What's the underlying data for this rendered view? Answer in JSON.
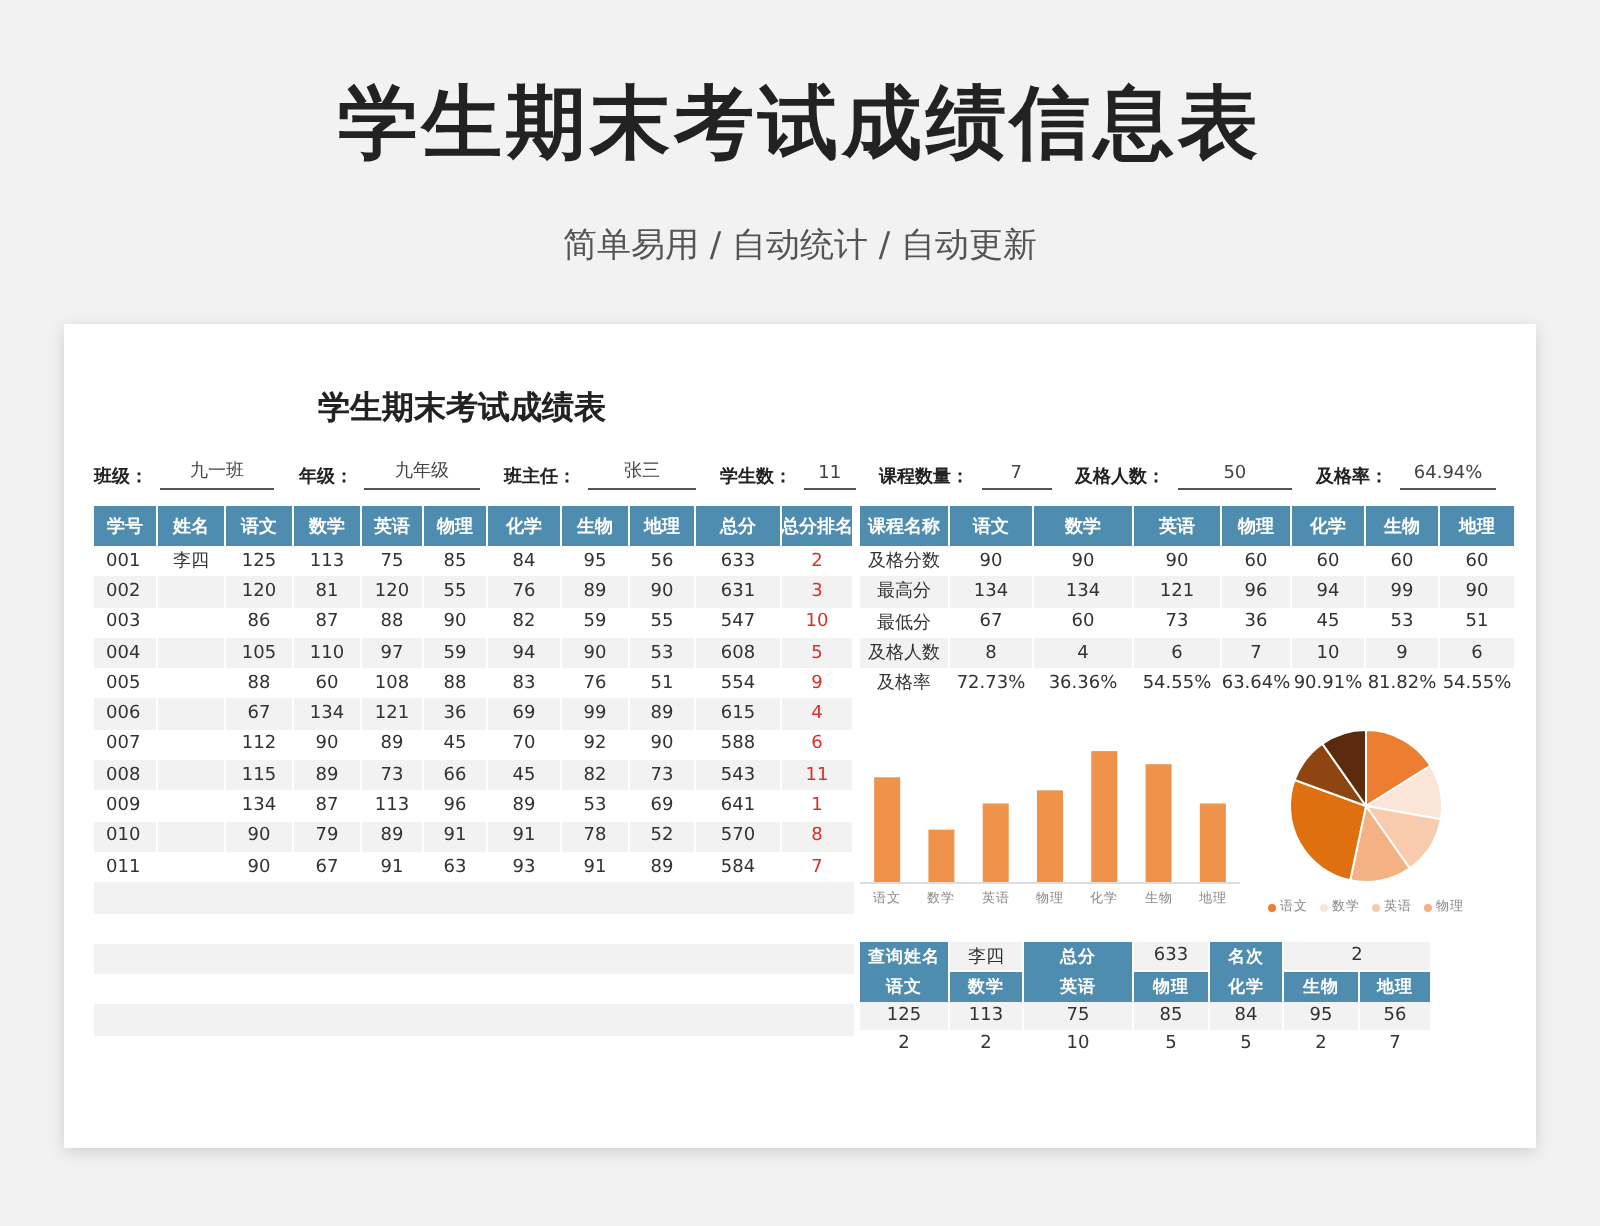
{
  "title": "学生期末考试成绩信息表",
  "subtitle": "简单易用 / 自动统计 / 自动更新",
  "sheet_title": "学生期末考试成绩表",
  "info": [
    {
      "label": "班级：",
      "value": "九一班"
    },
    {
      "label": "年级：",
      "value": "九年级"
    },
    {
      "label": "班主任：",
      "value": "张三"
    },
    {
      "label": "学生数：",
      "value": "11"
    },
    {
      "label": "课程数量：",
      "value": "7"
    },
    {
      "label": "及格人数：",
      "value": "50"
    },
    {
      "label": "及格率：",
      "value": "64.94%"
    }
  ],
  "scores": {
    "columns": [
      "学号",
      "姓名",
      "语文",
      "数学",
      "英语",
      "物理",
      "化学",
      "生物",
      "地理",
      "总分",
      "总分排名"
    ],
    "rows": [
      [
        "001",
        "李四",
        "125",
        "113",
        "75",
        "85",
        "84",
        "95",
        "56",
        "633",
        "2"
      ],
      [
        "002",
        "",
        "120",
        "81",
        "120",
        "55",
        "76",
        "89",
        "90",
        "631",
        "3"
      ],
      [
        "003",
        "",
        "86",
        "87",
        "88",
        "90",
        "82",
        "59",
        "55",
        "547",
        "10"
      ],
      [
        "004",
        "",
        "105",
        "110",
        "97",
        "59",
        "94",
        "90",
        "53",
        "608",
        "5"
      ],
      [
        "005",
        "",
        "88",
        "60",
        "108",
        "88",
        "83",
        "76",
        "51",
        "554",
        "9"
      ],
      [
        "006",
        "",
        "67",
        "134",
        "121",
        "36",
        "69",
        "99",
        "89",
        "615",
        "4"
      ],
      [
        "007",
        "",
        "112",
        "90",
        "89",
        "45",
        "70",
        "92",
        "90",
        "588",
        "6"
      ],
      [
        "008",
        "",
        "115",
        "89",
        "73",
        "66",
        "45",
        "82",
        "73",
        "543",
        "11"
      ],
      [
        "009",
        "",
        "134",
        "87",
        "113",
        "96",
        "89",
        "53",
        "69",
        "641",
        "1"
      ],
      [
        "010",
        "",
        "90",
        "79",
        "89",
        "91",
        "91",
        "78",
        "52",
        "570",
        "8"
      ],
      [
        "011",
        "",
        "90",
        "67",
        "91",
        "63",
        "93",
        "91",
        "89",
        "584",
        "7"
      ]
    ]
  },
  "summary": {
    "columns": [
      "课程名称",
      "语文",
      "数学",
      "英语",
      "物理",
      "化学",
      "生物",
      "地理"
    ],
    "rows": [
      [
        "及格分数",
        "90",
        "90",
        "90",
        "60",
        "60",
        "60",
        "60"
      ],
      [
        "最高分",
        "134",
        "134",
        "121",
        "96",
        "94",
        "99",
        "90"
      ],
      [
        "最低分",
        "67",
        "60",
        "73",
        "36",
        "45",
        "53",
        "51"
      ],
      [
        "及格人数",
        "8",
        "4",
        "6",
        "7",
        "10",
        "9",
        "6"
      ],
      [
        "及格率",
        "72.73%",
        "36.36%",
        "54.55%",
        "63.64%",
        "90.91%",
        "81.82%",
        "54.55%"
      ]
    ]
  },
  "bar_chart": {
    "categories": [
      "语文",
      "数学",
      "英语",
      "物理",
      "化学",
      "生物",
      "地理"
    ]
  },
  "pie_chart": {
    "legend": [
      {
        "label": "语文",
        "color": "#ed7d31"
      },
      {
        "label": "数学",
        "color": "#fbe5d6"
      },
      {
        "label": "英语",
        "color": "#f8cbad"
      },
      {
        "label": "物理",
        "color": "#f4b183"
      }
    ]
  },
  "query": {
    "top": [
      {
        "kind": "label",
        "text": "查询姓名"
      },
      {
        "kind": "value",
        "text": "李四"
      },
      {
        "kind": "label",
        "text": "总分"
      },
      {
        "kind": "value",
        "text": "633"
      },
      {
        "kind": "label",
        "text": "名次"
      },
      {
        "kind": "value",
        "text": "2"
      }
    ],
    "columns": [
      "语文",
      "数学",
      "英语",
      "物理",
      "化学",
      "生物",
      "地理"
    ],
    "rows": [
      [
        "125",
        "113",
        "75",
        "85",
        "84",
        "95",
        "56"
      ],
      [
        "2",
        "2",
        "10",
        "5",
        "5",
        "2",
        "7"
      ]
    ]
  }
}
